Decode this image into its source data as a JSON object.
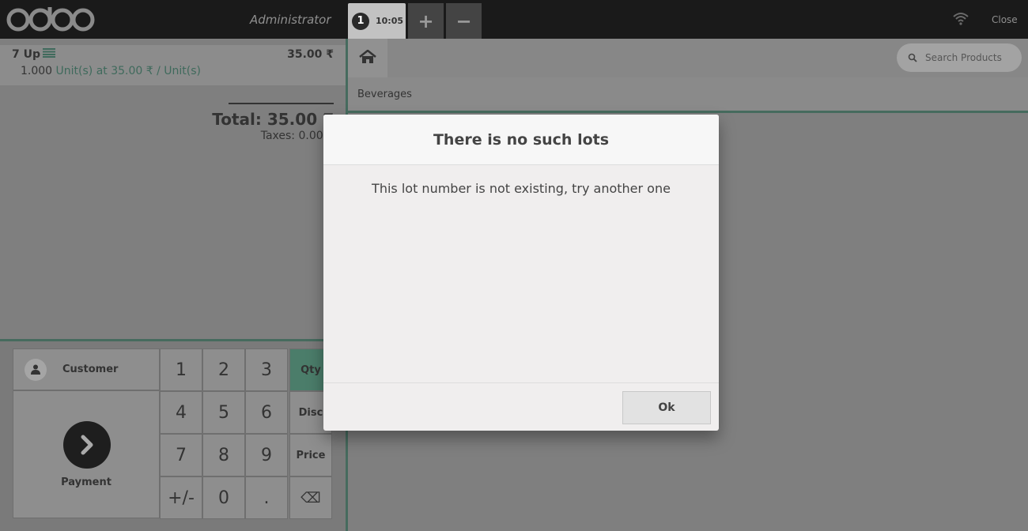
{
  "header": {
    "logo_text": "odoo",
    "username": "Administrator",
    "order": {
      "number": "1",
      "time": "10:05"
    },
    "add_order_icon": "+",
    "remove_order_icon": "−",
    "close_label": "Close"
  },
  "orderline": {
    "product": "7 Up",
    "price": "35.00 ₹",
    "quantity": "1.000",
    "unit_info": "Unit(s) at 35.00 ₹ / Unit(s)"
  },
  "summary": {
    "total": "Total: 35.00 ₹",
    "taxes": "Taxes: 0.00 ₹"
  },
  "actionpad": {
    "customer_label": "Customer",
    "payment_label": "Payment"
  },
  "numpad": {
    "keys": [
      "1",
      "2",
      "3",
      "4",
      "5",
      "6",
      "7",
      "8",
      "9",
      "+/-",
      "0",
      "."
    ],
    "modes": [
      "Qty",
      "Disc",
      "Price"
    ],
    "active_mode": "Qty",
    "backspace_icon": "⌫"
  },
  "products": {
    "search_placeholder": "Search Products",
    "breadcrumb": "Beverages"
  },
  "dialog": {
    "title": "There is no such lots",
    "body": "This lot number is not existing, try another one",
    "ok_label": "Ok"
  },
  "colors": {
    "accent": "#466b5e",
    "header_bg": "#1a1a1a"
  }
}
